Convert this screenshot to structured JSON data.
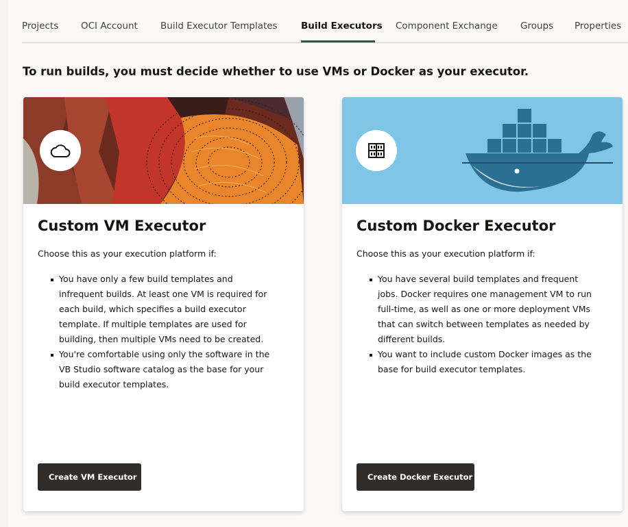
{
  "tabs": [
    {
      "label": "Projects"
    },
    {
      "label": "OCI Account"
    },
    {
      "label": "Build Executor Templates"
    },
    {
      "label": "Build Executors",
      "active": true
    },
    {
      "label": "Component Exchange"
    },
    {
      "label": "Groups"
    },
    {
      "label": "Properties"
    }
  ],
  "heading": "To run builds, you must decide whether to use VMs or Docker as your executor.",
  "vm_card": {
    "icon": "cloud-icon",
    "title": "Custom VM Executor",
    "intro": "Choose this as your execution platform if:",
    "bullets": [
      "You have only a few build templates and infrequent builds. At least one VM is required for each build, which specifies a build executor template. If multiple templates are used for building, then multiple VMs need to be created.",
      "You're comfortable using only the software in the VB Studio software catalog as the base for your build executor templates."
    ],
    "button": "Create VM Executor"
  },
  "docker_card": {
    "icon": "container-grid-icon",
    "title": "Custom Docker Executor",
    "intro": "Choose this as your execution platform if:",
    "bullets": [
      "You have several build templates and frequent jobs. Docker requires one management VM to run full-time, as well as one or more deployment VMs that can switch between templates as needed by different builds.",
      "You want to include custom Docker images as the base for build executor templates."
    ],
    "button": "Create Docker Executor"
  },
  "colors": {
    "accent": "#2b5a43",
    "button_bg": "#312d2a",
    "docker_banner": "#7fc6e6"
  }
}
